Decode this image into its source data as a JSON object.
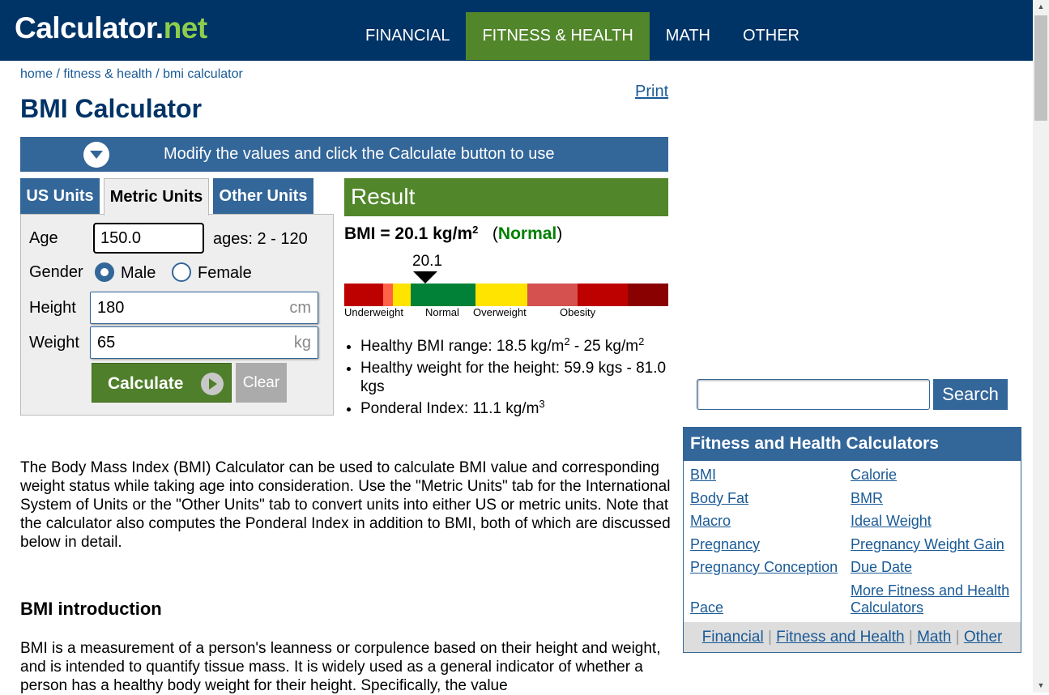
{
  "header": {
    "logo": {
      "main": "Calculator",
      "dot": ".",
      "accent": "net"
    },
    "nav": [
      {
        "label": "FINANCIAL",
        "active": false
      },
      {
        "label": "FITNESS & HEALTH",
        "active": true
      },
      {
        "label": "MATH",
        "active": false
      },
      {
        "label": "OTHER",
        "active": false
      }
    ]
  },
  "breadcrumb": {
    "home": "home",
    "sep": " / ",
    "section": "fitness & health",
    "current": "bmi calculator"
  },
  "print_label": "Print",
  "page_title": "BMI Calculator",
  "modify_bar": {
    "text": "Modify the values and click the Calculate button to use"
  },
  "tabs": [
    {
      "label": "US Units",
      "active": false
    },
    {
      "label": "Metric Units",
      "active": true
    },
    {
      "label": "Other Units",
      "active": false
    }
  ],
  "form": {
    "age_label": "Age",
    "age_value": "150.0",
    "age_hint": "ages: 2 - 120",
    "gender_label": "Gender",
    "gender_options": [
      {
        "label": "Male",
        "checked": true
      },
      {
        "label": "Female",
        "checked": false
      }
    ],
    "height_label": "Height",
    "height_value": "180",
    "height_unit": "cm",
    "weight_label": "Weight",
    "weight_value": "65",
    "weight_unit": "kg",
    "calculate_label": "Calculate",
    "clear_label": "Clear"
  },
  "result": {
    "title": "Result",
    "bmi_prefix": "BMI = 20.1 kg/m",
    "bmi_exp": "2",
    "status_open": "(",
    "status": "Normal",
    "status_close": ")",
    "gauge_value": "20.1",
    "gauge_position": 0.25,
    "gauge_labels": [
      "Underweight",
      "Normal",
      "Overweight",
      "Obesity"
    ],
    "healthy_range_prefix": "Healthy BMI range: 18.5 kg/m",
    "healthy_range_exp1": "2",
    "healthy_range_mid": " - 25 kg/m",
    "healthy_range_exp2": "2",
    "healthy_weight": "Healthy weight for the height: 59.9 kgs - 81.0 kgs",
    "ponderal_prefix": "Ponderal Index: 11.1 kg/m",
    "ponderal_exp": "3"
  },
  "colors": {
    "header_bg": "#003366",
    "nav_active": "#51862a",
    "accent_blue": "#336699",
    "result_green": "#51862a",
    "status_green": "#008000",
    "gauge": [
      "#bd0000",
      "#ff6347",
      "#ffe400",
      "#008137",
      "#ffe400",
      "#d45150",
      "#bd0000",
      "#8a0101"
    ]
  },
  "intro_text": "The Body Mass Index (BMI) Calculator can be used to calculate BMI value and corresponding weight status while taking age into consideration. Use the \"Metric Units\" tab for the International System of Units or the \"Other Units\" tab to convert units into either US or metric units. Note that the calculator also computes the Ponderal Index in addition to BMI, both of which are discussed below in detail.",
  "section": {
    "heading": "BMI introduction",
    "text": "BMI is a measurement of a person's leanness or corpulence based on their height and weight, and is intended to quantify tissue mass. It is widely used as a general indicator of whether a person has a healthy body weight for their height. Specifically, the value"
  },
  "sidebar": {
    "search_placeholder": "",
    "search_label": "Search",
    "box_title": "Fitness and Health Calculators",
    "links": [
      "BMI",
      "Calorie",
      "Body Fat",
      "BMR",
      "Macro",
      "Ideal Weight",
      "Pregnancy",
      "Pregnancy Weight Gain",
      "Pregnancy Conception",
      "Due Date",
      "Pace",
      "More Fitness and Health Calculators"
    ],
    "footer_links": [
      "Financial",
      "Fitness and Health",
      "Math",
      "Other"
    ],
    "footer_sep": " | "
  }
}
